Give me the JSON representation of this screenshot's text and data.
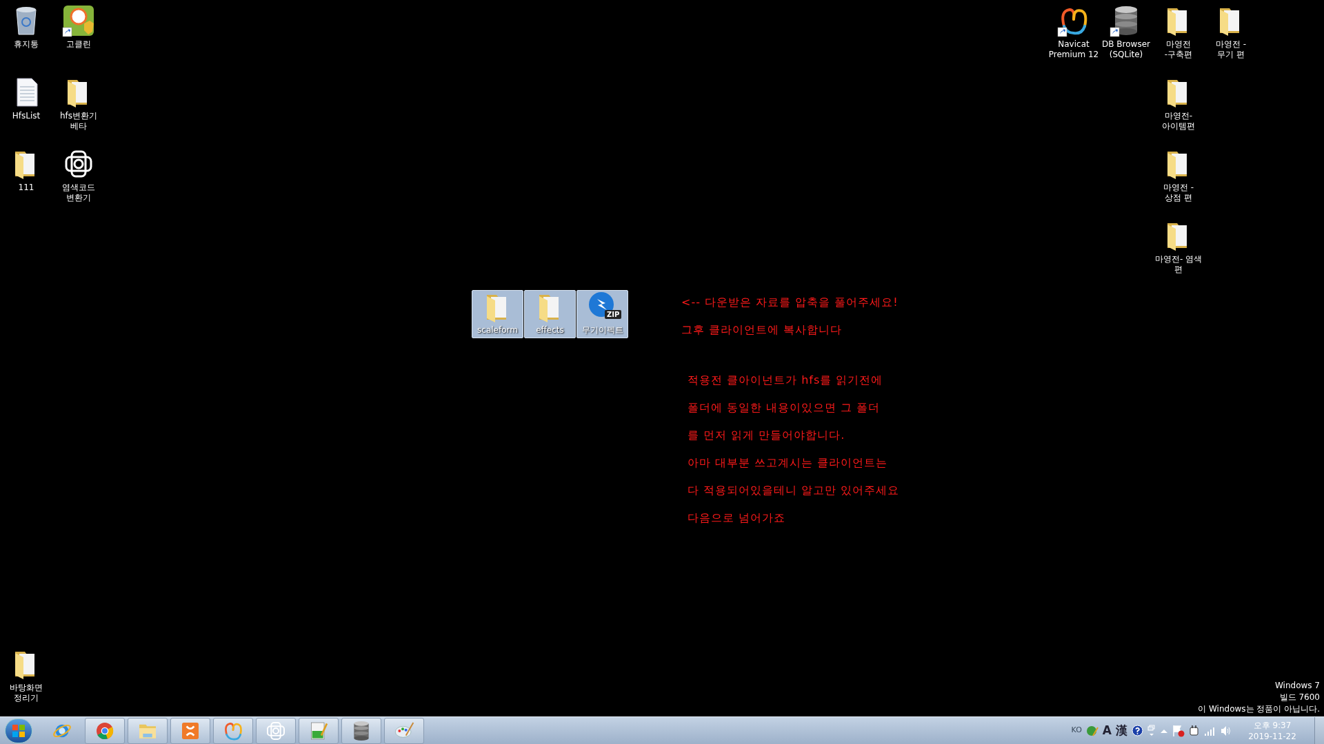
{
  "desktop": {
    "left_icons": [
      {
        "kind": "bin",
        "lines": [
          "휴지통"
        ],
        "shortcut": false
      },
      {
        "kind": "cleaner",
        "lines": [
          "고클린"
        ],
        "shortcut": true
      },
      {
        "kind": "document",
        "lines": [
          "HfsList"
        ],
        "shortcut": false
      },
      {
        "kind": "folder",
        "lines": [
          "hfs변환기",
          "베타"
        ],
        "shortcut": false
      },
      {
        "kind": "folder",
        "lines": [
          "111"
        ],
        "shortcut": false
      },
      {
        "kind": "knot",
        "lines": [
          "염색코드",
          "변환기"
        ],
        "shortcut": false
      }
    ],
    "right_top_icons": [
      {
        "kind": "navicat",
        "lines": [
          "Navicat",
          "Premium 12"
        ],
        "shortcut": true
      },
      {
        "kind": "database",
        "lines": [
          "DB Browser",
          "(SQLite)"
        ],
        "shortcut": true
      },
      {
        "kind": "folder",
        "lines": [
          "마영전",
          "-구축편"
        ],
        "shortcut": false
      },
      {
        "kind": "folder",
        "lines": [
          "마영전 -",
          "무기 편"
        ],
        "shortcut": false
      }
    ],
    "right_column_icons": [
      {
        "kind": "folder",
        "lines": [
          "마영전-",
          "아이템편"
        ],
        "shortcut": false
      },
      {
        "kind": "folder",
        "lines": [
          "마영전 -",
          "상점 편"
        ],
        "shortcut": false
      },
      {
        "kind": "folder",
        "lines": [
          "마영전- 염색",
          "편"
        ],
        "shortcut": false
      }
    ],
    "bottom_icon": {
      "kind": "folder",
      "lines": [
        "바탕화면",
        "정리기"
      ],
      "shortcut": false
    },
    "center_icons": [
      {
        "kind": "folder",
        "lines": [
          "scaleform"
        ],
        "selected": true
      },
      {
        "kind": "folder",
        "lines": [
          "effects"
        ],
        "selected": true
      },
      {
        "kind": "zip",
        "lines": [
          "무기이펙트"
        ],
        "badge": "ZIP",
        "selected": true
      }
    ],
    "instructions": [
      "<-- 다운받은 자료를 압축을 풀어주세요!",
      "그후 클라이언트에 복사합니다"
    ],
    "notes": [
      "적용전 클아이넌트가 hfs를 읽기전에",
      "폴더에 동일한 내용이있으면 그 폴더",
      "를 먼저 읽게 만들어야합니다.",
      "아마 대부분 쓰고계시는 클라이언트는",
      "다 적용되어있을테니 알고만 있어주세요",
      "다음으로 넘어가죠"
    ],
    "os_notice": [
      "Windows 7",
      "빌드 7600",
      "이 Windows는 정품이 아닙니다."
    ]
  },
  "taskbar": {
    "buttons": [
      {
        "kind": "ie",
        "running": false
      },
      {
        "kind": "chrome",
        "running": true
      },
      {
        "kind": "explorer",
        "running": true
      },
      {
        "kind": "xampp",
        "running": true
      },
      {
        "kind": "navicat",
        "running": true
      },
      {
        "kind": "knot",
        "running": true
      },
      {
        "kind": "notepad",
        "running": true
      },
      {
        "kind": "database",
        "running": true
      },
      {
        "kind": "paint",
        "running": true
      }
    ],
    "language": "KO",
    "ime_labels": [
      "A",
      "漢"
    ],
    "time": "오후 9:37",
    "date": "2019-11-22"
  }
}
